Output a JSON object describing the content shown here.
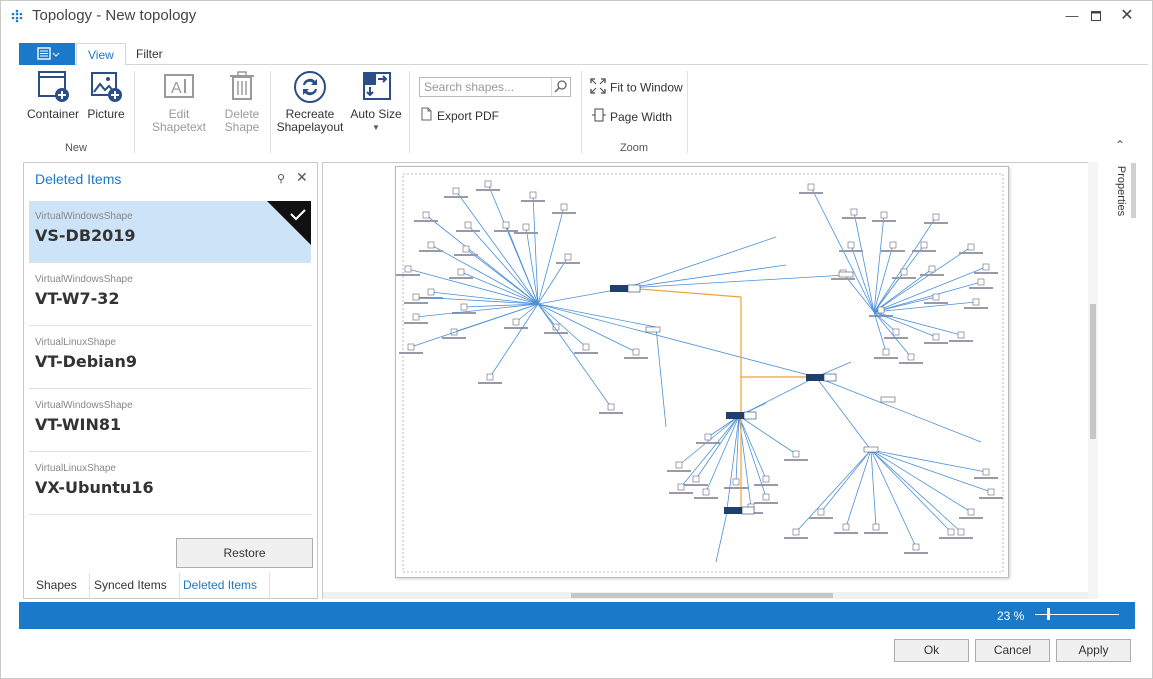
{
  "window": {
    "title": "Topology - New topology"
  },
  "ribbon": {
    "tabs": [
      "View",
      "Filter"
    ],
    "new_group": {
      "label": "New",
      "container": "Container",
      "picture": "Picture"
    },
    "edit": {
      "shapetext": "Edit Shapetext",
      "delete_line1": "Delete",
      "delete_line2": "Shape"
    },
    "layout": {
      "recreate_line1": "Recreate",
      "recreate_line2": "Shapelayout",
      "autosize": "Auto Size"
    },
    "search": {
      "placeholder": "Search shapes..."
    },
    "export_pdf": "Export PDF",
    "zoom_group": {
      "label": "Zoom",
      "fit": "Fit to Window",
      "page_width": "Page Width"
    }
  },
  "panel": {
    "title": "Deleted Items",
    "items": [
      {
        "type": "VirtualWindowsShape",
        "name": "VS-DB2019",
        "selected": true
      },
      {
        "type": "VirtualWindowsShape",
        "name": "VT-W7-32"
      },
      {
        "type": "VirtualLinuxShape",
        "name": "VT-Debian9"
      },
      {
        "type": "VirtualWindowsShape",
        "name": "VT-WIN81"
      },
      {
        "type": "VirtualLinuxShape",
        "name": "VX-Ubuntu16"
      }
    ],
    "restore": "Restore",
    "tabs": [
      "Shapes",
      "Synced Items",
      "Deleted Items"
    ]
  },
  "properties": {
    "label": "Properties"
  },
  "status": {
    "zoom": "23 %"
  },
  "footer": {
    "ok": "Ok",
    "cancel": "Cancel",
    "apply": "Apply"
  },
  "colors": {
    "accent": "#1b79c9",
    "link_line": "#4a90d9",
    "orange_line": "#f0a030",
    "switch_node": "#1f3f6e"
  }
}
